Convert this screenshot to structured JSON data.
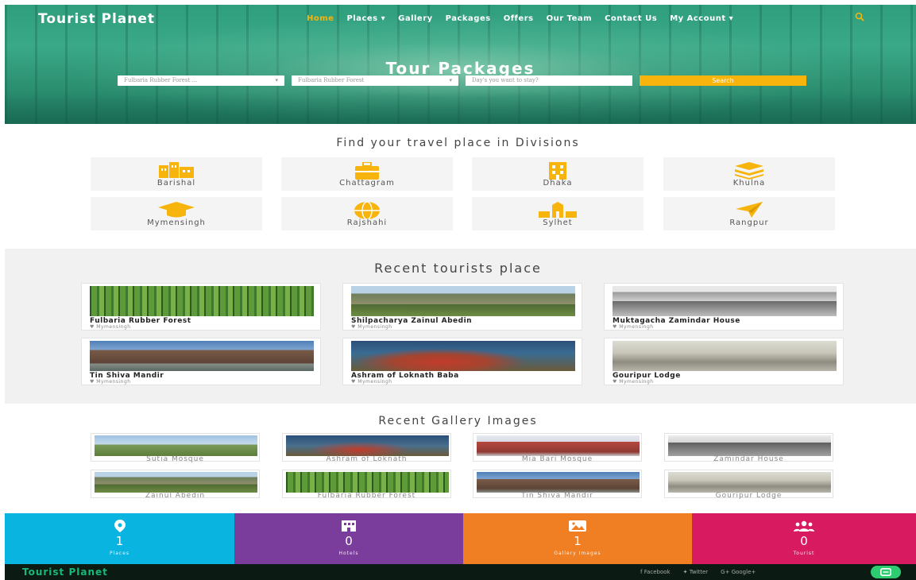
{
  "brand": "Tourist Planet",
  "nav": {
    "items": [
      {
        "label": "Home",
        "active": true
      },
      {
        "label": "Places ▾"
      },
      {
        "label": "Gallery"
      },
      {
        "label": "Packages"
      },
      {
        "label": "Offers"
      },
      {
        "label": "Our Team"
      },
      {
        "label": "Contact Us"
      },
      {
        "label": "My Account ▾"
      }
    ],
    "search_icon": "search-icon"
  },
  "hero": {
    "title": "Tour Packages",
    "select1": "Fulbaria Rubber Forest ...",
    "select2": "Fulbaria Rubber Forest",
    "days_placeholder": "Day's you want to stay?",
    "search_label": "Search"
  },
  "divisions": {
    "title": "Find your travel place in Divisions",
    "items": [
      {
        "label": "Barishal",
        "icon": "buildings-icon"
      },
      {
        "label": "Chattagram",
        "icon": "briefcase-icon"
      },
      {
        "label": "Dhaka",
        "icon": "building-icon"
      },
      {
        "label": "Khulna",
        "icon": "layers-icon"
      },
      {
        "label": "Mymensingh",
        "icon": "graduation-cap-icon"
      },
      {
        "label": "Rajshahi",
        "icon": "globe-icon"
      },
      {
        "label": "Sylhet",
        "icon": "landmark-icon"
      },
      {
        "label": "Rangpur",
        "icon": "paper-plane-icon"
      }
    ]
  },
  "recent_places": {
    "title": "Recent tourists place",
    "items": [
      {
        "name": "Fulbaria Rubber Forest",
        "location": "Mymensingh"
      },
      {
        "name": "Shilpacharya Zainul Abedin",
        "location": "Mymensingh"
      },
      {
        "name": "Muktagacha Zamindar House",
        "location": "Mymensingh"
      },
      {
        "name": "Tin Shiva Mandir",
        "location": "Mymensingh"
      },
      {
        "name": "Ashram of Loknath Baba",
        "location": "Mymensingh"
      },
      {
        "name": "Gouripur Lodge",
        "location": "Mymensingh"
      }
    ]
  },
  "gallery": {
    "title": "Recent Gallery Images",
    "items": [
      {
        "caption": "Sutia Mosque"
      },
      {
        "caption": "Ashram of Loknath"
      },
      {
        "caption": "Mia Bari Mosque"
      },
      {
        "caption": "Zamindar House"
      },
      {
        "caption": "Zainul Abedin"
      },
      {
        "caption": "Fulbaria Rubber Forest"
      },
      {
        "caption": "Tin Shiva Mandir"
      },
      {
        "caption": "Gouripur Lodge"
      }
    ]
  },
  "stats": [
    {
      "value": "1",
      "label": "Places",
      "color": "#0ab4e0",
      "icon": "map-pin-icon"
    },
    {
      "value": "0",
      "label": "Hotels",
      "color": "#7b3d9b",
      "icon": "hotel-icon"
    },
    {
      "value": "1",
      "label": "Gallery Images",
      "color": "#f07e23",
      "icon": "image-icon"
    },
    {
      "value": "0",
      "label": "Tourist",
      "color": "#d81b60",
      "icon": "users-icon"
    }
  ],
  "footer": {
    "brand": "Tourist Planet",
    "social": [
      {
        "label": "Facebook",
        "icon": "facebook-icon"
      },
      {
        "label": "Twitter",
        "icon": "twitter-icon"
      },
      {
        "label": "Google+",
        "icon": "google-plus-icon"
      }
    ]
  },
  "colors": {
    "accent": "#f6b40c",
    "footer_bg": "#0c1a14",
    "footer_brand": "#17b978"
  }
}
